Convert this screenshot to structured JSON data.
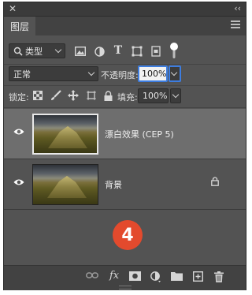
{
  "panel": {
    "tab_label": "图层"
  },
  "filter": {
    "kind_label": "类型"
  },
  "blend": {
    "mode": "正常",
    "opacity_label": "不透明度:",
    "opacity_value": "100%"
  },
  "lock_row": {
    "lock_label": "锁定:",
    "fill_label": "填充:",
    "fill_value": "100%"
  },
  "layers": [
    {
      "name": "漂白效果 (CEP 5)",
      "selected": true,
      "locked": false
    },
    {
      "name": "背景",
      "selected": false,
      "locked": true
    }
  ],
  "step_badge": "4",
  "bottom_icons": [
    "link-icon",
    "fx-icon",
    "mask-icon",
    "adjustment-icon",
    "folder-icon",
    "new-layer-icon",
    "trash-icon"
  ],
  "colors": {
    "panel_bg": "#535353",
    "selected_layer": "#6e6e6e",
    "badge": "#e34a2d",
    "focus": "#3d7de0"
  }
}
